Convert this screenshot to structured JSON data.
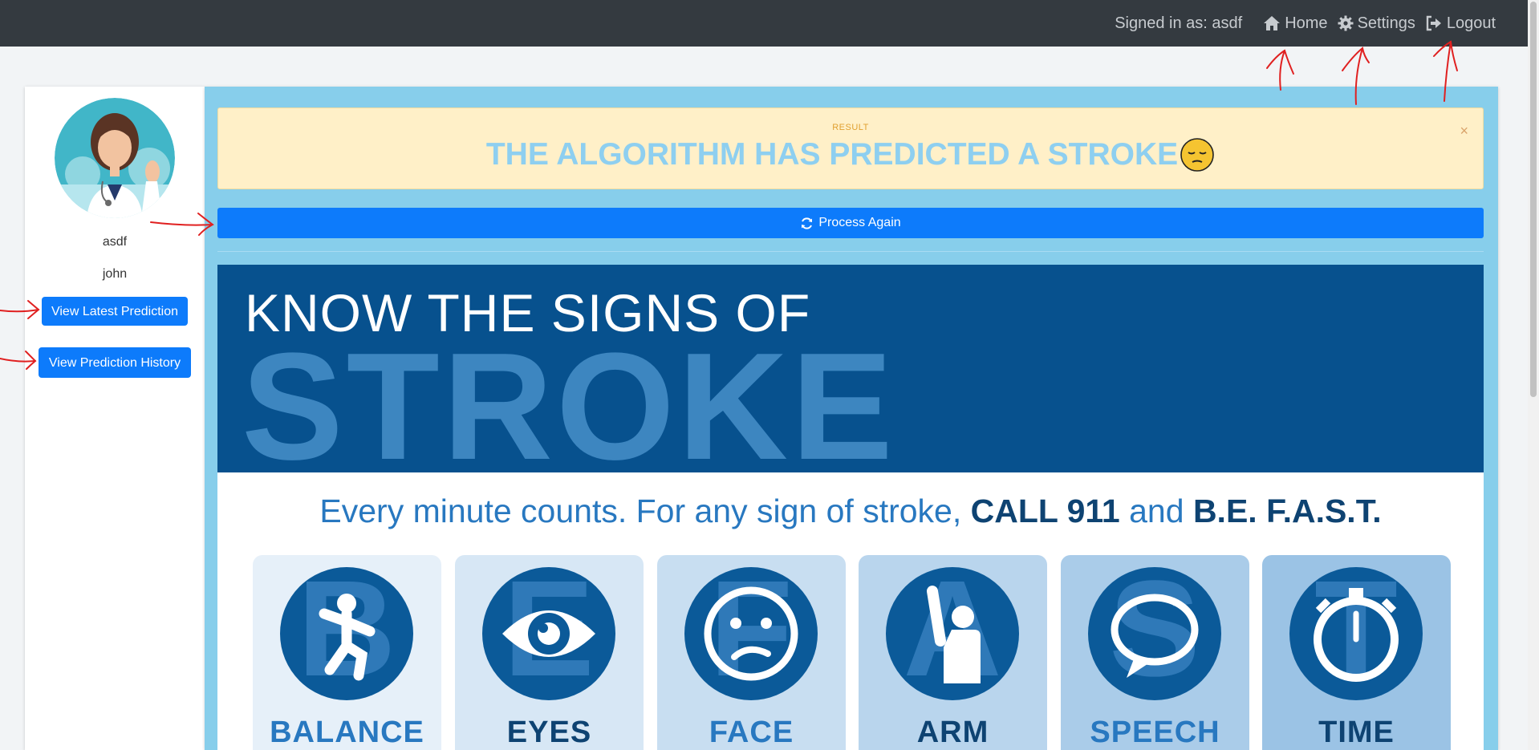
{
  "navbar": {
    "signed_in": "Signed in as: asdf",
    "home": "Home",
    "settings": "Settings",
    "logout": "Logout"
  },
  "sidebar": {
    "username": "asdf",
    "name": "john",
    "btn_latest": "View Latest Prediction",
    "btn_history": "View Prediction History"
  },
  "alert": {
    "label": "RESULT",
    "message": "THE ALGORITHM HAS PREDICTED A STROKE",
    "emoji": "😔",
    "close": "×"
  },
  "process_button": "Process Again",
  "infographic": {
    "title_line1": "KNOW THE SIGNS OF",
    "title_line2": "STROKE",
    "subtitle_pre": "Every minute counts. For any sign of stroke, ",
    "subtitle_b1": "CALL 911",
    "subtitle_mid": " and ",
    "subtitle_b2": "B.E. F.A.S.T.",
    "tiles": [
      {
        "letter": "B",
        "label": "BALANCE",
        "label_color": "#2878c0",
        "bg": "#e6f0f9"
      },
      {
        "letter": "E",
        "label": "EYES",
        "label_color": "#0e4372",
        "bg": "#d7e7f5"
      },
      {
        "letter": "F",
        "label": "FACE",
        "label_color": "#2878c0",
        "bg": "#c8def1"
      },
      {
        "letter": "A",
        "label": "ARM",
        "label_color": "#0e4372",
        "bg": "#b9d5ed"
      },
      {
        "letter": "S",
        "label": "SPEECH",
        "label_color": "#2878c0",
        "bg": "#aacce9"
      },
      {
        "letter": "T",
        "label": "TIME",
        "label_color": "#0e4372",
        "bg": "#9bc3e5"
      }
    ]
  },
  "colors": {
    "navbar": "#343a40",
    "primary_button": "#0d7bfb",
    "panel": "#87ceeb",
    "alert_bg": "#fff0c8",
    "annotation": "#e02020"
  }
}
